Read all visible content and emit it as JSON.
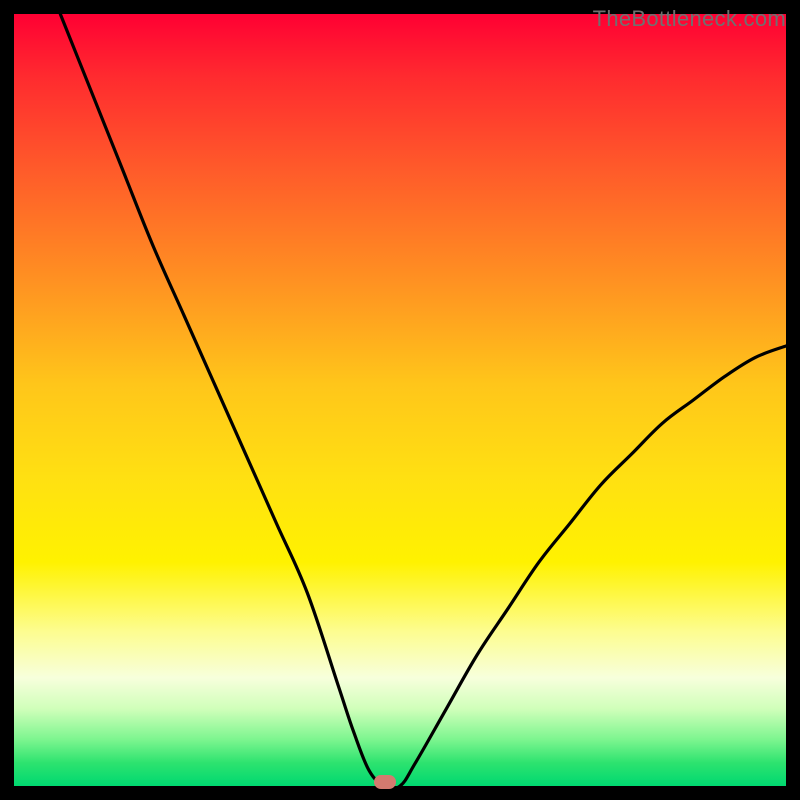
{
  "watermark": "TheBottleneck.com",
  "marker": {
    "x": 48.1,
    "y_pct": 0
  },
  "chart_data": {
    "type": "line",
    "title": "",
    "xlabel": "",
    "ylabel": "",
    "xlim": [
      0,
      100
    ],
    "ylim": [
      0,
      100
    ],
    "grid": false,
    "legend": false,
    "series": [
      {
        "name": "bottleneck-curve",
        "x": [
          6,
          10,
          14,
          18,
          22,
          26,
          30,
          34,
          38,
          42,
          44,
          46,
          48,
          50,
          52,
          56,
          60,
          64,
          68,
          72,
          76,
          80,
          84,
          88,
          92,
          96,
          100
        ],
        "y": [
          100,
          90,
          80,
          70,
          61,
          52,
          43,
          34,
          25,
          13,
          7,
          2,
          0,
          0,
          3,
          10,
          17,
          23,
          29,
          34,
          39,
          43,
          47,
          50,
          53,
          55.5,
          57
        ]
      }
    ],
    "annotations": [
      {
        "type": "marker",
        "x": 48.1,
        "y": 0,
        "label": "optimal-point"
      }
    ],
    "background_gradient": {
      "direction": "vertical",
      "stops": [
        {
          "pct_from_top": 0,
          "color": "#ff0033",
          "meaning": "severe"
        },
        {
          "pct_from_top": 50,
          "color": "#ffd400",
          "meaning": "moderate"
        },
        {
          "pct_from_top": 100,
          "color": "#00d870",
          "meaning": "optimal"
        }
      ]
    }
  }
}
